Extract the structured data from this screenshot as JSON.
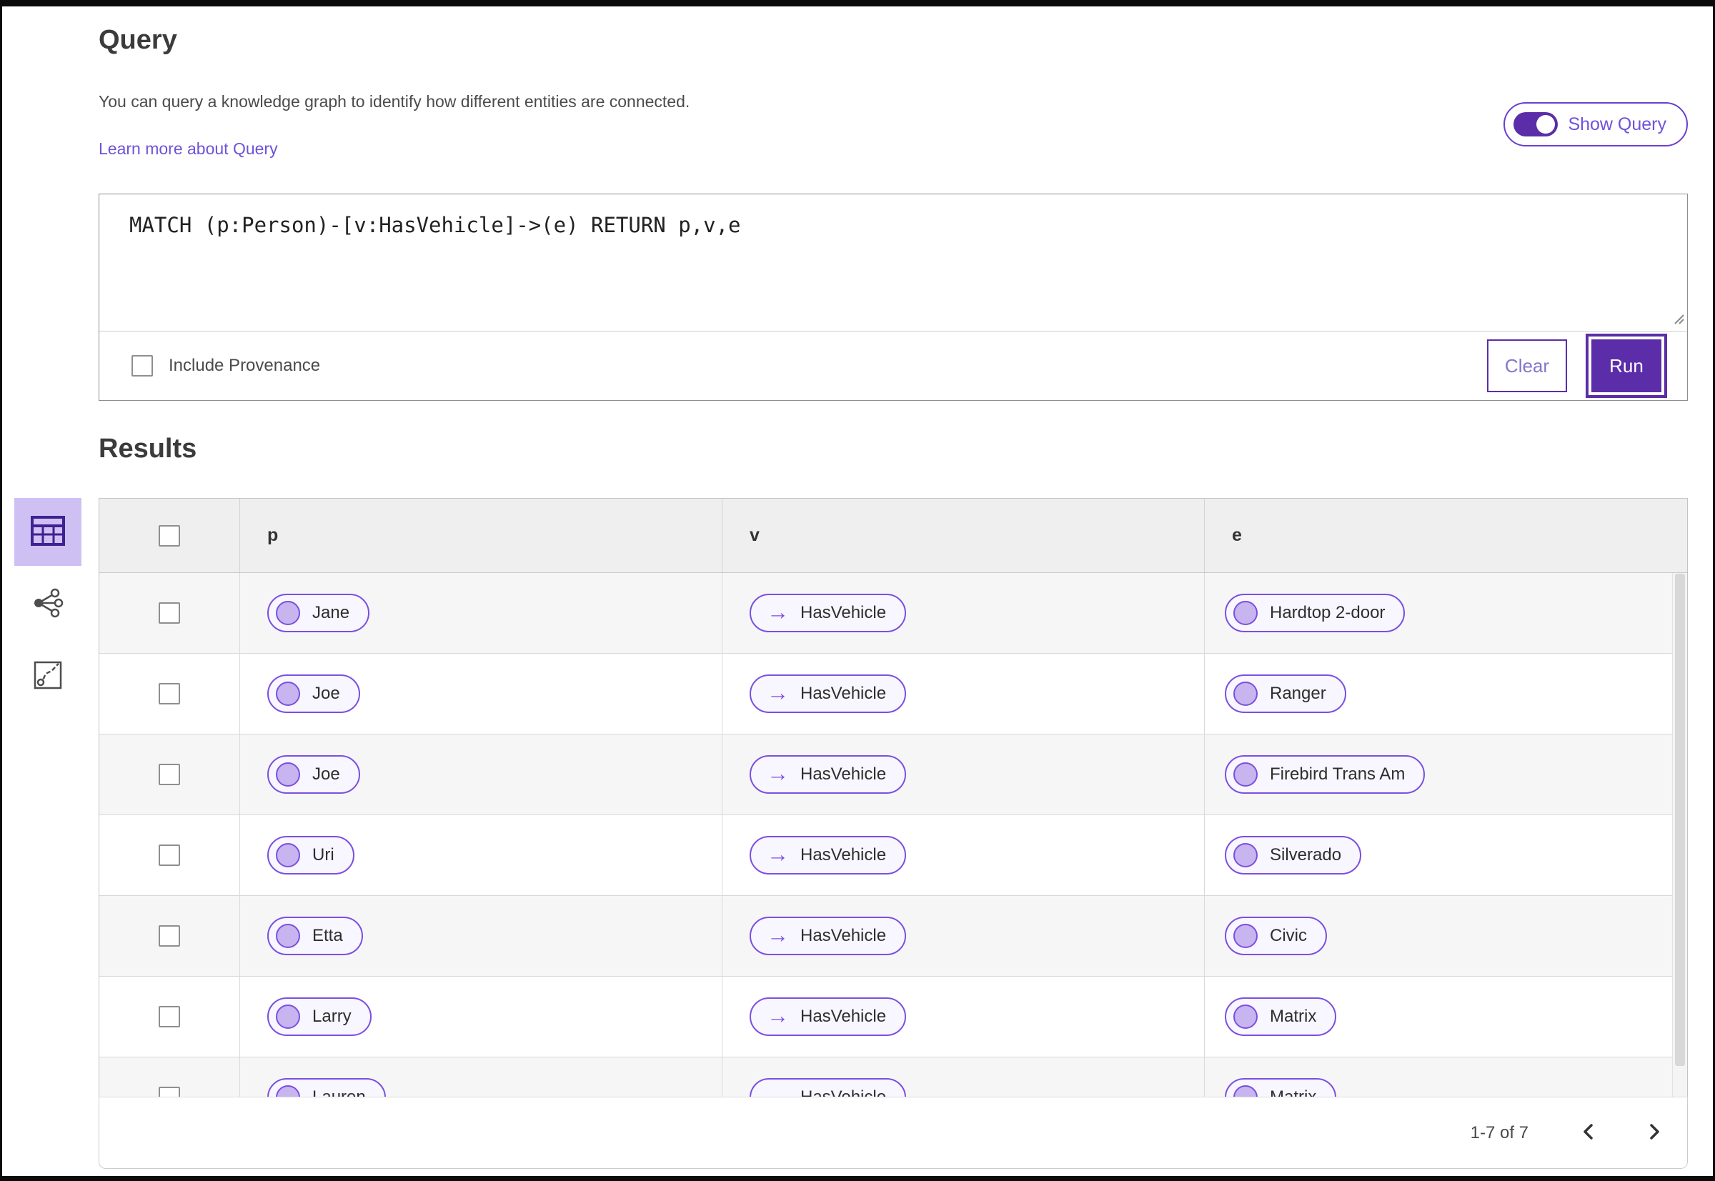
{
  "header": {
    "title": "Query",
    "description": "You can query a knowledge graph to identify how different entities are connected.",
    "learn_more_link": "Learn more about Query",
    "show_query_toggle": {
      "label": "Show Query",
      "state": "on"
    }
  },
  "query_editor": {
    "query_text": "MATCH (p:Person)-[v:HasVehicle]->(e) RETURN p,v,e",
    "include_provenance": {
      "label": "Include Provenance",
      "checked": false
    },
    "clear_button": "Clear",
    "run_button": "Run"
  },
  "results": {
    "heading": "Results",
    "view_switcher": {
      "active": "table-view",
      "items": [
        {
          "name": "table-view",
          "icon": "table-icon"
        },
        {
          "name": "graph-view",
          "icon": "network-graph-icon"
        },
        {
          "name": "chart-view",
          "icon": "route-chart-icon"
        }
      ]
    },
    "table": {
      "columns": [
        "p",
        "v",
        "e"
      ],
      "relationship_arrow": "→",
      "rows": [
        {
          "p": "Jane",
          "v": "HasVehicle",
          "e": "Hardtop 2-door"
        },
        {
          "p": "Joe",
          "v": "HasVehicle",
          "e": "Ranger"
        },
        {
          "p": "Joe",
          "v": "HasVehicle",
          "e": "Firebird Trans Am"
        },
        {
          "p": "Uri",
          "v": "HasVehicle",
          "e": "Silverado"
        },
        {
          "p": "Etta",
          "v": "HasVehicle",
          "e": "Civic"
        },
        {
          "p": "Larry",
          "v": "HasVehicle",
          "e": "Matrix"
        },
        {
          "p": "Lauren",
          "v": "HasVehicle",
          "e": "Matrix"
        }
      ]
    },
    "pagination": {
      "range_label": "1-7 of 7"
    }
  },
  "colors": {
    "accent": "#5b2da8",
    "pill_border": "#7b4fe0",
    "pill_background": "#f8f6fe",
    "node_fill": "#c8b4ee",
    "active_view_background": "#cfc0f4",
    "link": "#6f53d8"
  }
}
